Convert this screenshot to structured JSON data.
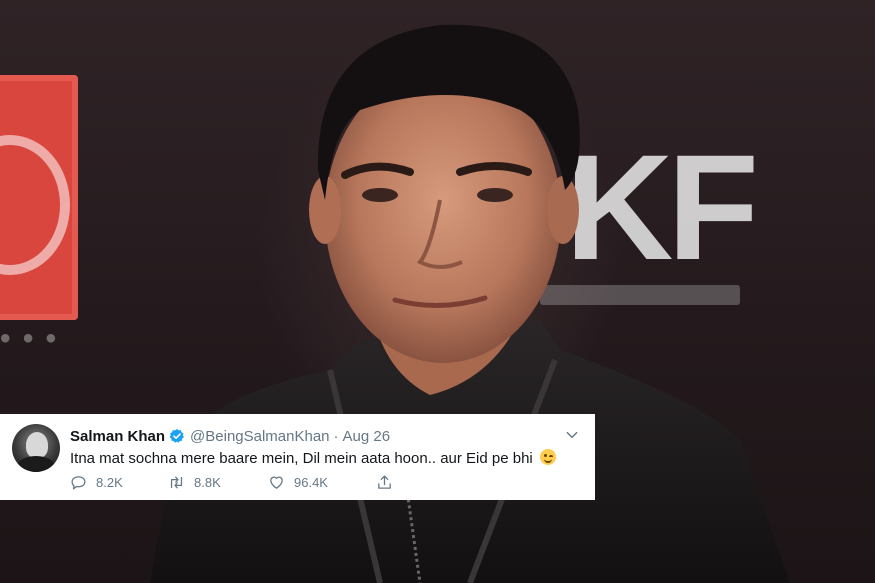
{
  "photo": {
    "subject": "man in black leather jacket at event backdrop",
    "backdrop_colors": {
      "left_logo": "#d9463e",
      "background": "#2a1f22"
    }
  },
  "tweet": {
    "author_name": "Salman Khan",
    "verified_icon": "verified-badge-icon",
    "handle": "@BeingSalmanKhan",
    "separator": "·",
    "date": "Aug 26",
    "text": "Itna mat sochna mere baare mein, Dil mein aata hoon.. aur Eid pe bhi",
    "emoji": "winking-face",
    "replies": "8.2K",
    "retweets": "8.8K",
    "likes": "96.4K",
    "accent_color": "#1da1f2",
    "text_color": "#14171a",
    "muted_color": "#657786"
  }
}
